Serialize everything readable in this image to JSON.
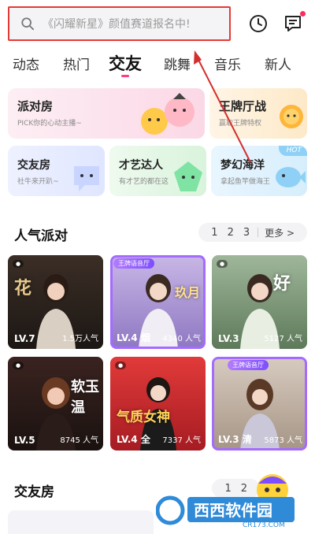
{
  "search": {
    "placeholder": "《闪耀新星》颜值赛道报名中!"
  },
  "tabs": [
    "动态",
    "热门",
    "交友",
    "跳舞",
    "音乐",
    "新人"
  ],
  "active_tab": "交友",
  "feature_cards": [
    {
      "title": "派对房",
      "subtitle": "PICK你的心动主播~"
    },
    {
      "title": "王牌厅战",
      "subtitle": "赢取王牌特权"
    },
    {
      "title": "交友房",
      "subtitle": "社牛来开趴~"
    },
    {
      "title": "才艺达人",
      "subtitle": "有才艺的都在这"
    },
    {
      "title": "梦幻海洋",
      "subtitle": "拿起鱼竿做海王",
      "badge": "HOT"
    }
  ],
  "section1": {
    "title": "人气派对",
    "pages": [
      "1",
      "2",
      "3"
    ],
    "more": "更多 >"
  },
  "rooms": [
    {
      "level": "LV.7",
      "heat": "1.5万人气",
      "tag": "",
      "deco": "花"
    },
    {
      "level": "LV.4 烟",
      "heat": "4340 人气",
      "tag": "王牌语音厅",
      "deco": "玖月"
    },
    {
      "level": "LV.3",
      "heat": "5127 人气",
      "tag": "",
      "deco": "好"
    },
    {
      "level": "LV.5",
      "heat": "8745 人气",
      "tag": "",
      "deco": "软玉温"
    },
    {
      "level": "LV.4 全",
      "heat": "7337 人气",
      "tag": "",
      "deco": "气质女神"
    },
    {
      "level": "LV.3 清",
      "heat": "5873 人气",
      "tag": "王牌语音厅",
      "deco": ""
    }
  ],
  "section2": {
    "title": "交友房",
    "pages": [
      "1",
      "2"
    ]
  },
  "watermark": {
    "text": "西西软件园",
    "sub": "CR173.COM"
  },
  "colors": {
    "accent": "#ff3d7f",
    "highlight_box": "#e53935",
    "arrow": "#d32f2f"
  }
}
